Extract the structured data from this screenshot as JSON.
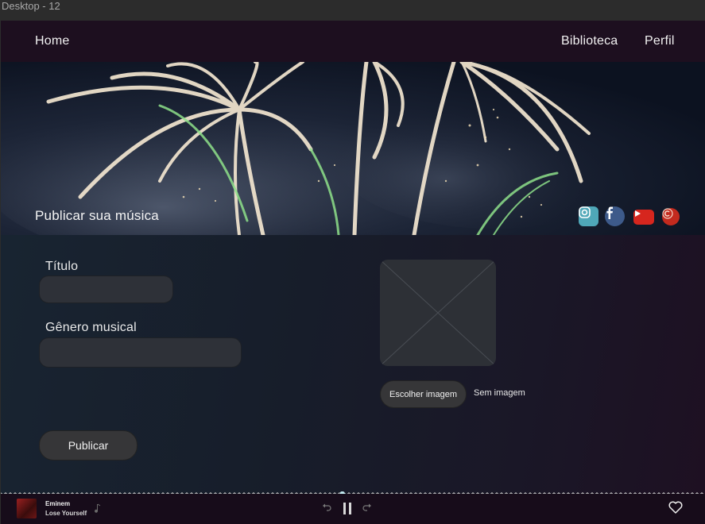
{
  "window": {
    "title": "Desktop - 12"
  },
  "nav": {
    "home": "Home",
    "library": "Biblioteca",
    "profile": "Perfil"
  },
  "banner": {
    "title": "Publicar sua música",
    "social": [
      "instagram-icon",
      "facebook-icon",
      "youtube-icon",
      "copyright-icon"
    ]
  },
  "form": {
    "title_label": "Título",
    "title_value": "",
    "genre_label": "Gênero musical",
    "genre_value": "",
    "choose_image": "Escolher imagem",
    "no_image": "Sem imagem",
    "publish": "Publicar"
  },
  "player": {
    "artist": "Eminem",
    "song": "Lose Yourself",
    "progress": 0.485,
    "state": "playing"
  },
  "colors": {
    "nav_bg": "#1d0f1f",
    "field_bg": "#2e3138",
    "button_bg": "#363638",
    "progress_dot": "#bfe6ec"
  }
}
